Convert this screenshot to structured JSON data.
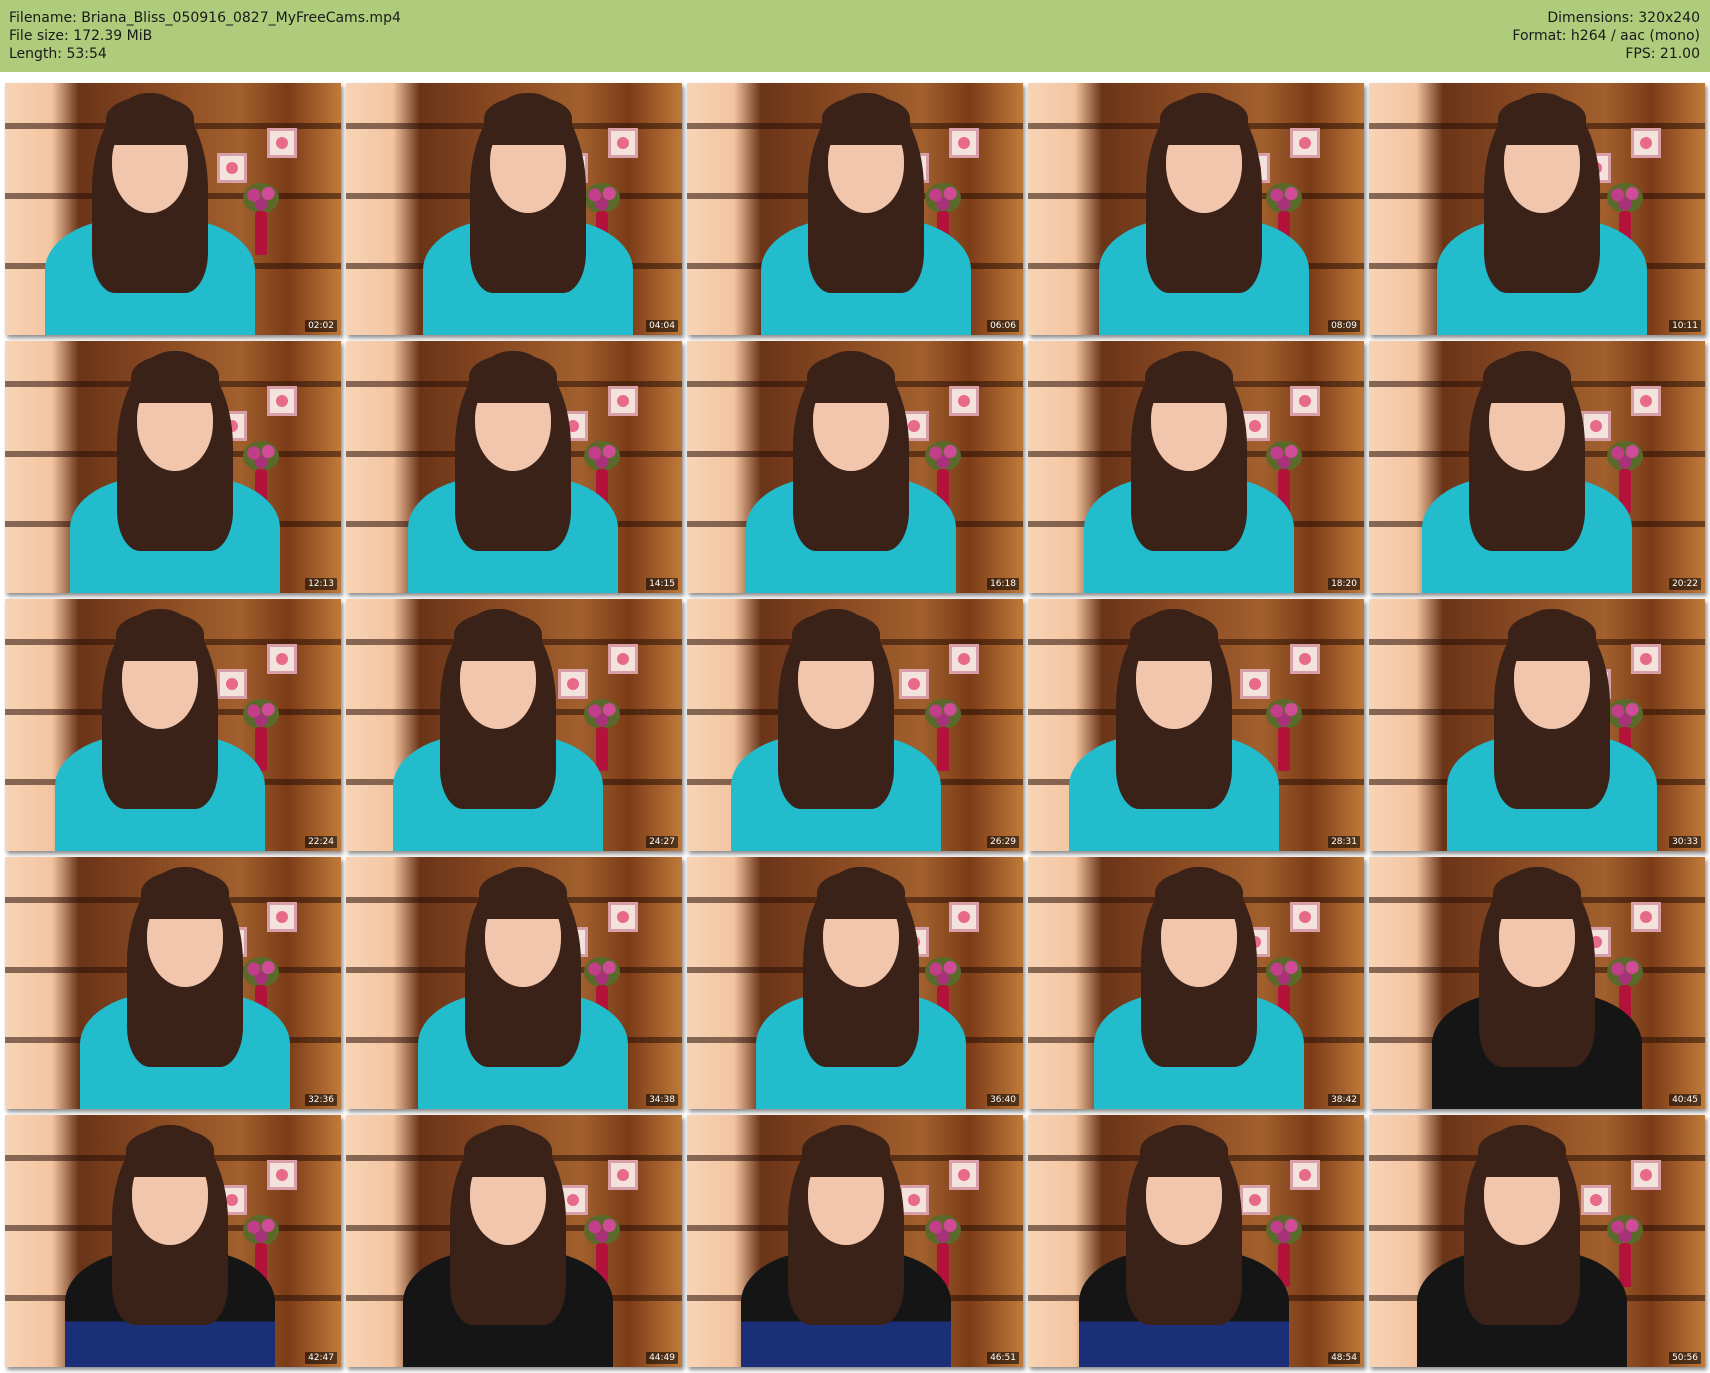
{
  "header": {
    "filename": "Filename: Briana_Bliss_050916_0827_MyFreeCams.mp4",
    "filesize": "File size: 172.39 MiB",
    "length": "Length: 53:54",
    "dimensions": "Dimensions: 320x240",
    "format": "Format: h264 / aac (mono)",
    "fps": "FPS: 21.00"
  },
  "colors": {
    "header_bg": "#afcb7c",
    "shirt_teal": "#22bccc",
    "dress_black": "#151515",
    "dress_blue": "#1b2f78"
  },
  "thumbnails": [
    {
      "time": "02:02",
      "outfit": "teal"
    },
    {
      "time": "04:04",
      "outfit": "teal"
    },
    {
      "time": "06:06",
      "outfit": "teal"
    },
    {
      "time": "08:09",
      "outfit": "teal"
    },
    {
      "time": "10:11",
      "outfit": "teal"
    },
    {
      "time": "12:13",
      "outfit": "teal"
    },
    {
      "time": "14:15",
      "outfit": "teal"
    },
    {
      "time": "16:18",
      "outfit": "teal"
    },
    {
      "time": "18:20",
      "outfit": "teal"
    },
    {
      "time": "20:22",
      "outfit": "teal"
    },
    {
      "time": "22:24",
      "outfit": "teal"
    },
    {
      "time": "24:27",
      "outfit": "teal"
    },
    {
      "time": "26:29",
      "outfit": "teal"
    },
    {
      "time": "28:31",
      "outfit": "teal"
    },
    {
      "time": "30:33",
      "outfit": "teal"
    },
    {
      "time": "32:36",
      "outfit": "teal"
    },
    {
      "time": "34:38",
      "outfit": "teal"
    },
    {
      "time": "36:40",
      "outfit": "teal"
    },
    {
      "time": "38:42",
      "outfit": "teal"
    },
    {
      "time": "40:45",
      "outfit": "black"
    },
    {
      "time": "42:47",
      "outfit": "black-blue"
    },
    {
      "time": "44:49",
      "outfit": "black"
    },
    {
      "time": "46:51",
      "outfit": "black-blue"
    },
    {
      "time": "48:54",
      "outfit": "black-blue"
    },
    {
      "time": "50:56",
      "outfit": "black"
    }
  ]
}
